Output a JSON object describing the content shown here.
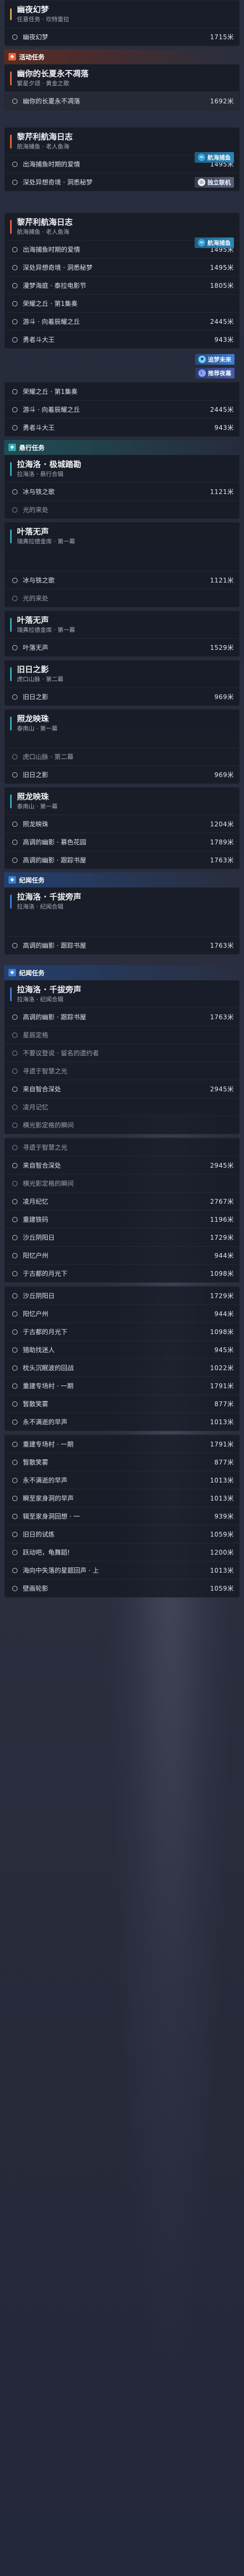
{
  "colors": {
    "accent_orange": "#e4663a",
    "accent_teal": "#38a9b8",
    "accent_blue": "#3f80d6",
    "accent_gold": "#d6a84a",
    "badge_cyan": "#3aa7d8"
  },
  "screen": {
    "top_panel": {
      "title": "幽夜幻梦",
      "subtitle": "任意任务 · 坎特雷拉",
      "items": [
        {
          "label": "幽夜幻梦",
          "dist": "1715米"
        }
      ]
    },
    "event_tag_1": "活动任务",
    "panel_a": {
      "title": "幽你的长夏永不凋落",
      "subtitle": "繁星夕颂 · 黄金之歌",
      "items": [
        {
          "label": "幽你的长夏永不凋落",
          "dist": "1692米"
        }
      ]
    },
    "panel_b": {
      "title": "黎芹利航海日志",
      "subtitle": "航海捕鱼 · 老人鱼海",
      "items": [
        {
          "label": "出海捕鱼时期的爱情",
          "dist": "1495米"
        },
        {
          "label": "深处异想奇境 · 洞悉秘梦",
          "dist": ""
        }
      ]
    },
    "badge_pill": "航海捕鱼",
    "badge_online": "独立联机",
    "panel_c": {
      "title": "黎芹利航海日志",
      "subtitle": "航海捕鱼 · 老人鱼海",
      "items": [
        {
          "label": "出海捕鱼时期的爱情",
          "dist": "1495米"
        },
        {
          "label": "深处异想奇境 · 洞悉秘梦",
          "dist": "1495米"
        },
        {
          "label": "漫梦海庭 · 泰拉电影节",
          "dist": "1805米"
        },
        {
          "label": "荣耀之丘 · 第1集奏",
          "dist": ""
        },
        {
          "label": "游斗 · 向着辰耀之丘",
          "dist": "2445米"
        },
        {
          "label": "勇者斗大王",
          "dist": "943米"
        }
      ]
    },
    "badge_dream": "追梦未来",
    "badge_recommend": "推荐夜幕",
    "panel_d": {
      "items": [
        {
          "label": "荣耀之丘 · 第1集奏",
          "dist": ""
        },
        {
          "label": "游斗 · 向着辰耀之丘",
          "dist": "2445米"
        },
        {
          "label": "勇者斗大王",
          "dist": "943米"
        }
      ]
    },
    "event_tag_2": "悬行任务",
    "panel_e": {
      "title": "拉海洛 · 极城踏勘",
      "subtitle": "拉海洛 · 悬行合辑",
      "items": [
        {
          "label": "冰与铁之歌",
          "dist": "1121米"
        },
        {
          "label": "光的来处",
          "dist": ""
        }
      ]
    },
    "panel_f": {
      "title": "叶落无声",
      "subtitle": "瑞弗拉德金库 · 第一幕",
      "items": [
        {
          "label": "冰与铁之歌",
          "dist": "1121米"
        },
        {
          "label": "光的来处",
          "dist": ""
        }
      ]
    },
    "panel_g": {
      "title": "叶落无声",
      "subtitle": "瑞弗拉德金库 · 第一幕",
      "items": [
        {
          "label": "叶落无声",
          "dist": "1529米"
        }
      ]
    },
    "panel_h": {
      "title": "旧日之影",
      "subtitle": "虎口山脉 · 第二幕",
      "items": [
        {
          "label": "旧日之影",
          "dist": "969米"
        }
      ]
    },
    "panel_i": {
      "title": "照龙映珠",
      "subtitle": "泰南山 · 第一幕",
      "items": [
        {
          "label": "虎口山脉 · 第二幕",
          "dist": ""
        },
        {
          "label": "旧日之影",
          "dist": "969米"
        }
      ]
    },
    "panel_j": {
      "title": "照龙映珠",
      "subtitle": "泰南山 · 第一幕",
      "items": [
        {
          "label": "照龙映珠",
          "dist": "1204米"
        },
        {
          "label": "高调的幽影 · 慕色花园",
          "dist": "1789米"
        },
        {
          "label": "高调的幽影 · 跟踪书屋",
          "dist": "1763米"
        }
      ]
    },
    "event_tag_3": "纪闻任务",
    "panel_k": {
      "title": "拉海洛 · 千拔旁声",
      "subtitle": "拉海洛 · 纪闻合辑",
      "items": [
        {
          "label": "高调的幽影 · 跟踪书屋",
          "dist": "1763米"
        }
      ]
    },
    "event_tag_4": "纪闻任务",
    "panel_l": {
      "title": "拉海洛 · 千拔旁声",
      "subtitle": "拉海洛 · 纪闻合辑",
      "items": [
        {
          "label": "高调的幽影 · 跟踪书屋",
          "dist": "1763米"
        },
        {
          "label": "星辰定格",
          "dist": ""
        },
        {
          "label": "不要议登说 · 留名的遗约者",
          "dist": ""
        },
        {
          "label": "寻遗于智慧之光",
          "dist": ""
        },
        {
          "label": "来自智合深处",
          "dist": "2945米"
        },
        {
          "label": "凌月记忆",
          "dist": ""
        },
        {
          "label": "横光影定格的瞬间",
          "dist": ""
        }
      ]
    },
    "panel_m": {
      "items": [
        {
          "label": "寻遗于智慧之光",
          "dist": ""
        },
        {
          "label": "来自智合深处",
          "dist": "2945米"
        },
        {
          "label": "横光影定格的瞬间",
          "dist": ""
        },
        {
          "label": "凌月纪忆",
          "dist": "2767米"
        },
        {
          "label": "重建铁码",
          "dist": "1196米"
        },
        {
          "label": "沙丘阴阳日",
          "dist": "1729米"
        },
        {
          "label": "阳忆户州",
          "dist": "944米"
        },
        {
          "label": "于古都的月光下",
          "dist": "1098米"
        }
      ]
    },
    "panel_n": {
      "items": [
        {
          "label": "沙丘阴阳日",
          "dist": "1729米"
        },
        {
          "label": "阳忆户州",
          "dist": "944米"
        },
        {
          "label": "于古都的月光下",
          "dist": "1098米"
        },
        {
          "label": "猎助找迷人",
          "dist": "945米"
        },
        {
          "label": "枕头沉眠波的回战",
          "dist": "1022米"
        },
        {
          "label": "重建专场村 · 一期",
          "dist": "1791米"
        },
        {
          "label": "暂散笑雾",
          "dist": "877米"
        },
        {
          "label": "永不满逝的早声",
          "dist": "1013米"
        }
      ]
    },
    "panel_o": {
      "items": [
        {
          "label": "重建专场村 · 一期",
          "dist": "1791米"
        },
        {
          "label": "暂散笑雾",
          "dist": "877米"
        },
        {
          "label": "永不满逝的早声",
          "dist": "1013米"
        },
        {
          "label": "瞬至家身洞的早声",
          "dist": "1013米"
        },
        {
          "label": "辑至家身洞回想 · 一",
          "dist": "939米"
        },
        {
          "label": "旧日的试炼",
          "dist": "1059米"
        },
        {
          "label": "跃动吧，龟舞蹈!",
          "dist": "1200米"
        },
        {
          "label": "海向中失落的星题回声 · 上",
          "dist": "1013米"
        },
        {
          "label": "壁画轮影",
          "dist": "1059米"
        }
      ]
    }
  }
}
